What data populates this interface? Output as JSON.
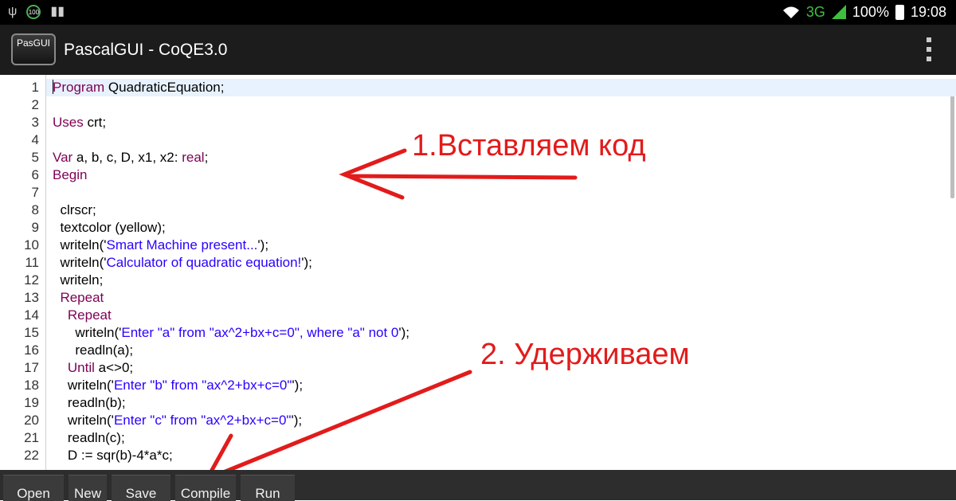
{
  "statusbar": {
    "left_icons": [
      "usb-icon",
      "battery-100-icon",
      "barcode-icon"
    ],
    "battery_badge": "100",
    "network": "3G",
    "battery": "100%",
    "time": "19:08"
  },
  "appbar": {
    "logo_text": "PasGUI",
    "title": "PascalGUI - CoQE3.0",
    "menu_icon": "overflow-menu-icon"
  },
  "editor": {
    "current_line": 1,
    "lines": [
      {
        "n": "1",
        "text": "Program QuadraticEquation;"
      },
      {
        "n": "2",
        "text": ""
      },
      {
        "n": "3",
        "text": "Uses crt;"
      },
      {
        "n": "4",
        "text": ""
      },
      {
        "n": "5",
        "text": "Var a, b, c, D, x1, x2: real;"
      },
      {
        "n": "6",
        "text": "Begin"
      },
      {
        "n": "7",
        "text": ""
      },
      {
        "n": "8",
        "text": "  clrscr;"
      },
      {
        "n": "9",
        "text": "  textcolor (yellow);"
      },
      {
        "n": "10",
        "text": "  writeln('Smart Machine present...');"
      },
      {
        "n": "11",
        "text": "  writeln('Calculator of quadratic equation!');"
      },
      {
        "n": "12",
        "text": "  writeln;"
      },
      {
        "n": "13",
        "text": "  Repeat"
      },
      {
        "n": "14",
        "text": "    Repeat"
      },
      {
        "n": "15",
        "text": "      writeln('Enter \"a\" from \"ax^2+bx+c=0\", where \"a\" not 0');"
      },
      {
        "n": "16",
        "text": "      readln(a);"
      },
      {
        "n": "17",
        "text": "    Until a<>0;"
      },
      {
        "n": "18",
        "text": "    writeln('Enter \"b\" from \"ax^2+bx+c=0\"');"
      },
      {
        "n": "19",
        "text": "    readln(b);"
      },
      {
        "n": "20",
        "text": "    writeln('Enter \"c\" from \"ax^2+bx+c=0\"');"
      },
      {
        "n": "21",
        "text": "    readln(c);"
      },
      {
        "n": "22",
        "text": "    D := sqr(b)-4*a*c;"
      }
    ],
    "keywords": [
      "Program",
      "Uses",
      "Var",
      "real",
      "Begin",
      "Repeat",
      "Until"
    ],
    "colors": {
      "keyword": "#7f0055",
      "string": "#2a00ff",
      "current_line": "#e8f2fe"
    }
  },
  "annotations": {
    "step1": "1.Вставляем код",
    "step2": "2. Удерживаем",
    "color": "#e21b1b"
  },
  "toolbar": {
    "buttons": [
      "Open",
      "New",
      "Save",
      "Compile",
      "Run"
    ]
  }
}
